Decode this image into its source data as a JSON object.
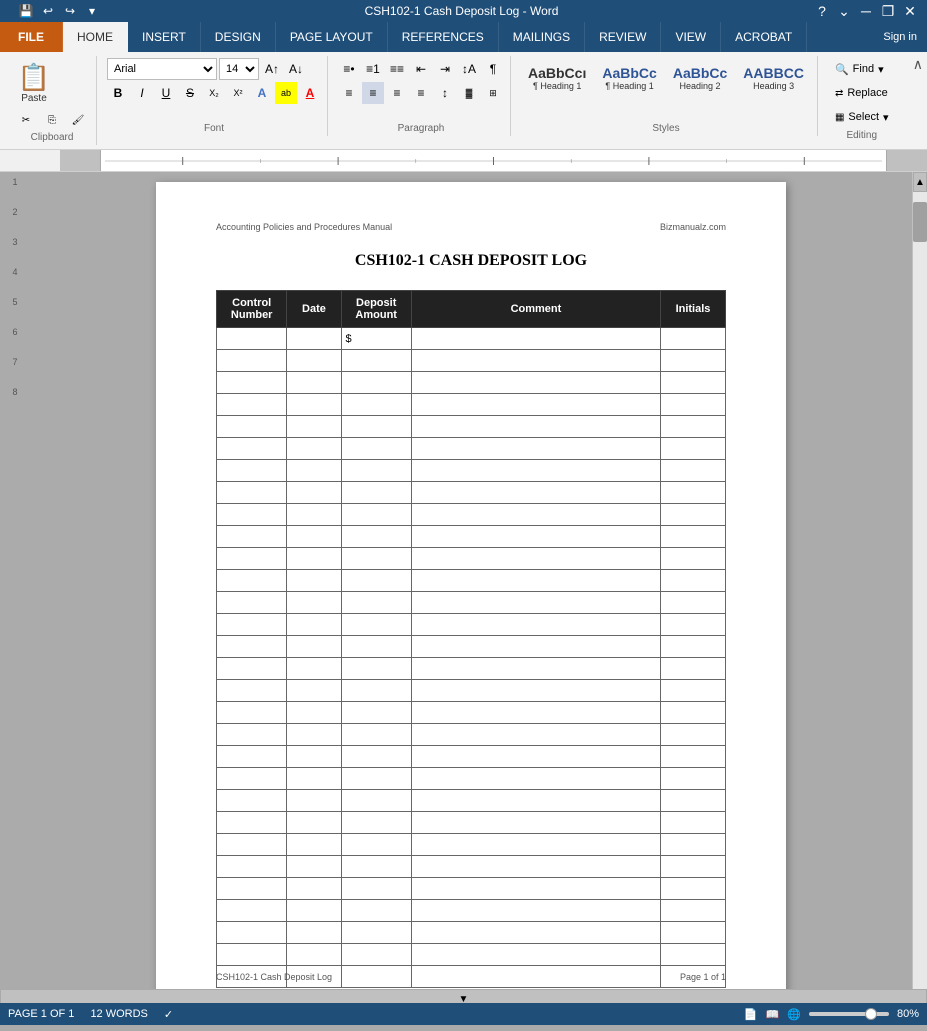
{
  "titleBar": {
    "title": "CSH102-1 Cash Deposit Log - Word",
    "helpBtn": "?",
    "minimizeBtn": "—",
    "restoreBtn": "❐",
    "closeBtn": "✕"
  },
  "quickAccess": {
    "saveIcon": "💾",
    "undoIcon": "↩",
    "redoIcon": "↪",
    "moreIcon": "▾"
  },
  "ribbonTabs": {
    "file": "FILE",
    "home": "HOME",
    "insert": "INSERT",
    "design": "DESIGN",
    "pageLayout": "PAGE LAYOUT",
    "references": "REFERENCES",
    "mailings": "MAILINGS",
    "review": "REVIEW",
    "view": "VIEW",
    "acrobat": "ACROBAT",
    "signIn": "Sign in"
  },
  "font": {
    "name": "Arial",
    "size": "14"
  },
  "styles": {
    "heading1": "¶ Heading 1",
    "heading2": "AaBbCc\nHeading 2",
    "heading3": "AABBCC\nHeading 3"
  },
  "editing": {
    "find": "Find",
    "replace": "Replace",
    "select": "Select"
  },
  "document": {
    "headerLeft": "Accounting Policies and Procedures Manual",
    "headerRight": "Bizmanualz.com",
    "title": "CSH102-1 CASH DEPOSIT LOG",
    "footerLeft": "CSH102-1 Cash Deposit Log",
    "footerRight": "Page 1 of 1"
  },
  "table": {
    "headers": [
      "Control\nNumber",
      "Date",
      "Deposit\nAmount",
      "Comment",
      "Initials"
    ],
    "firstRowDollar": "$",
    "rowCount": 30
  },
  "statusBar": {
    "page": "PAGE 1 OF 1",
    "words": "12 WORDS",
    "zoom": "80%",
    "proofingIcon": "✓"
  }
}
